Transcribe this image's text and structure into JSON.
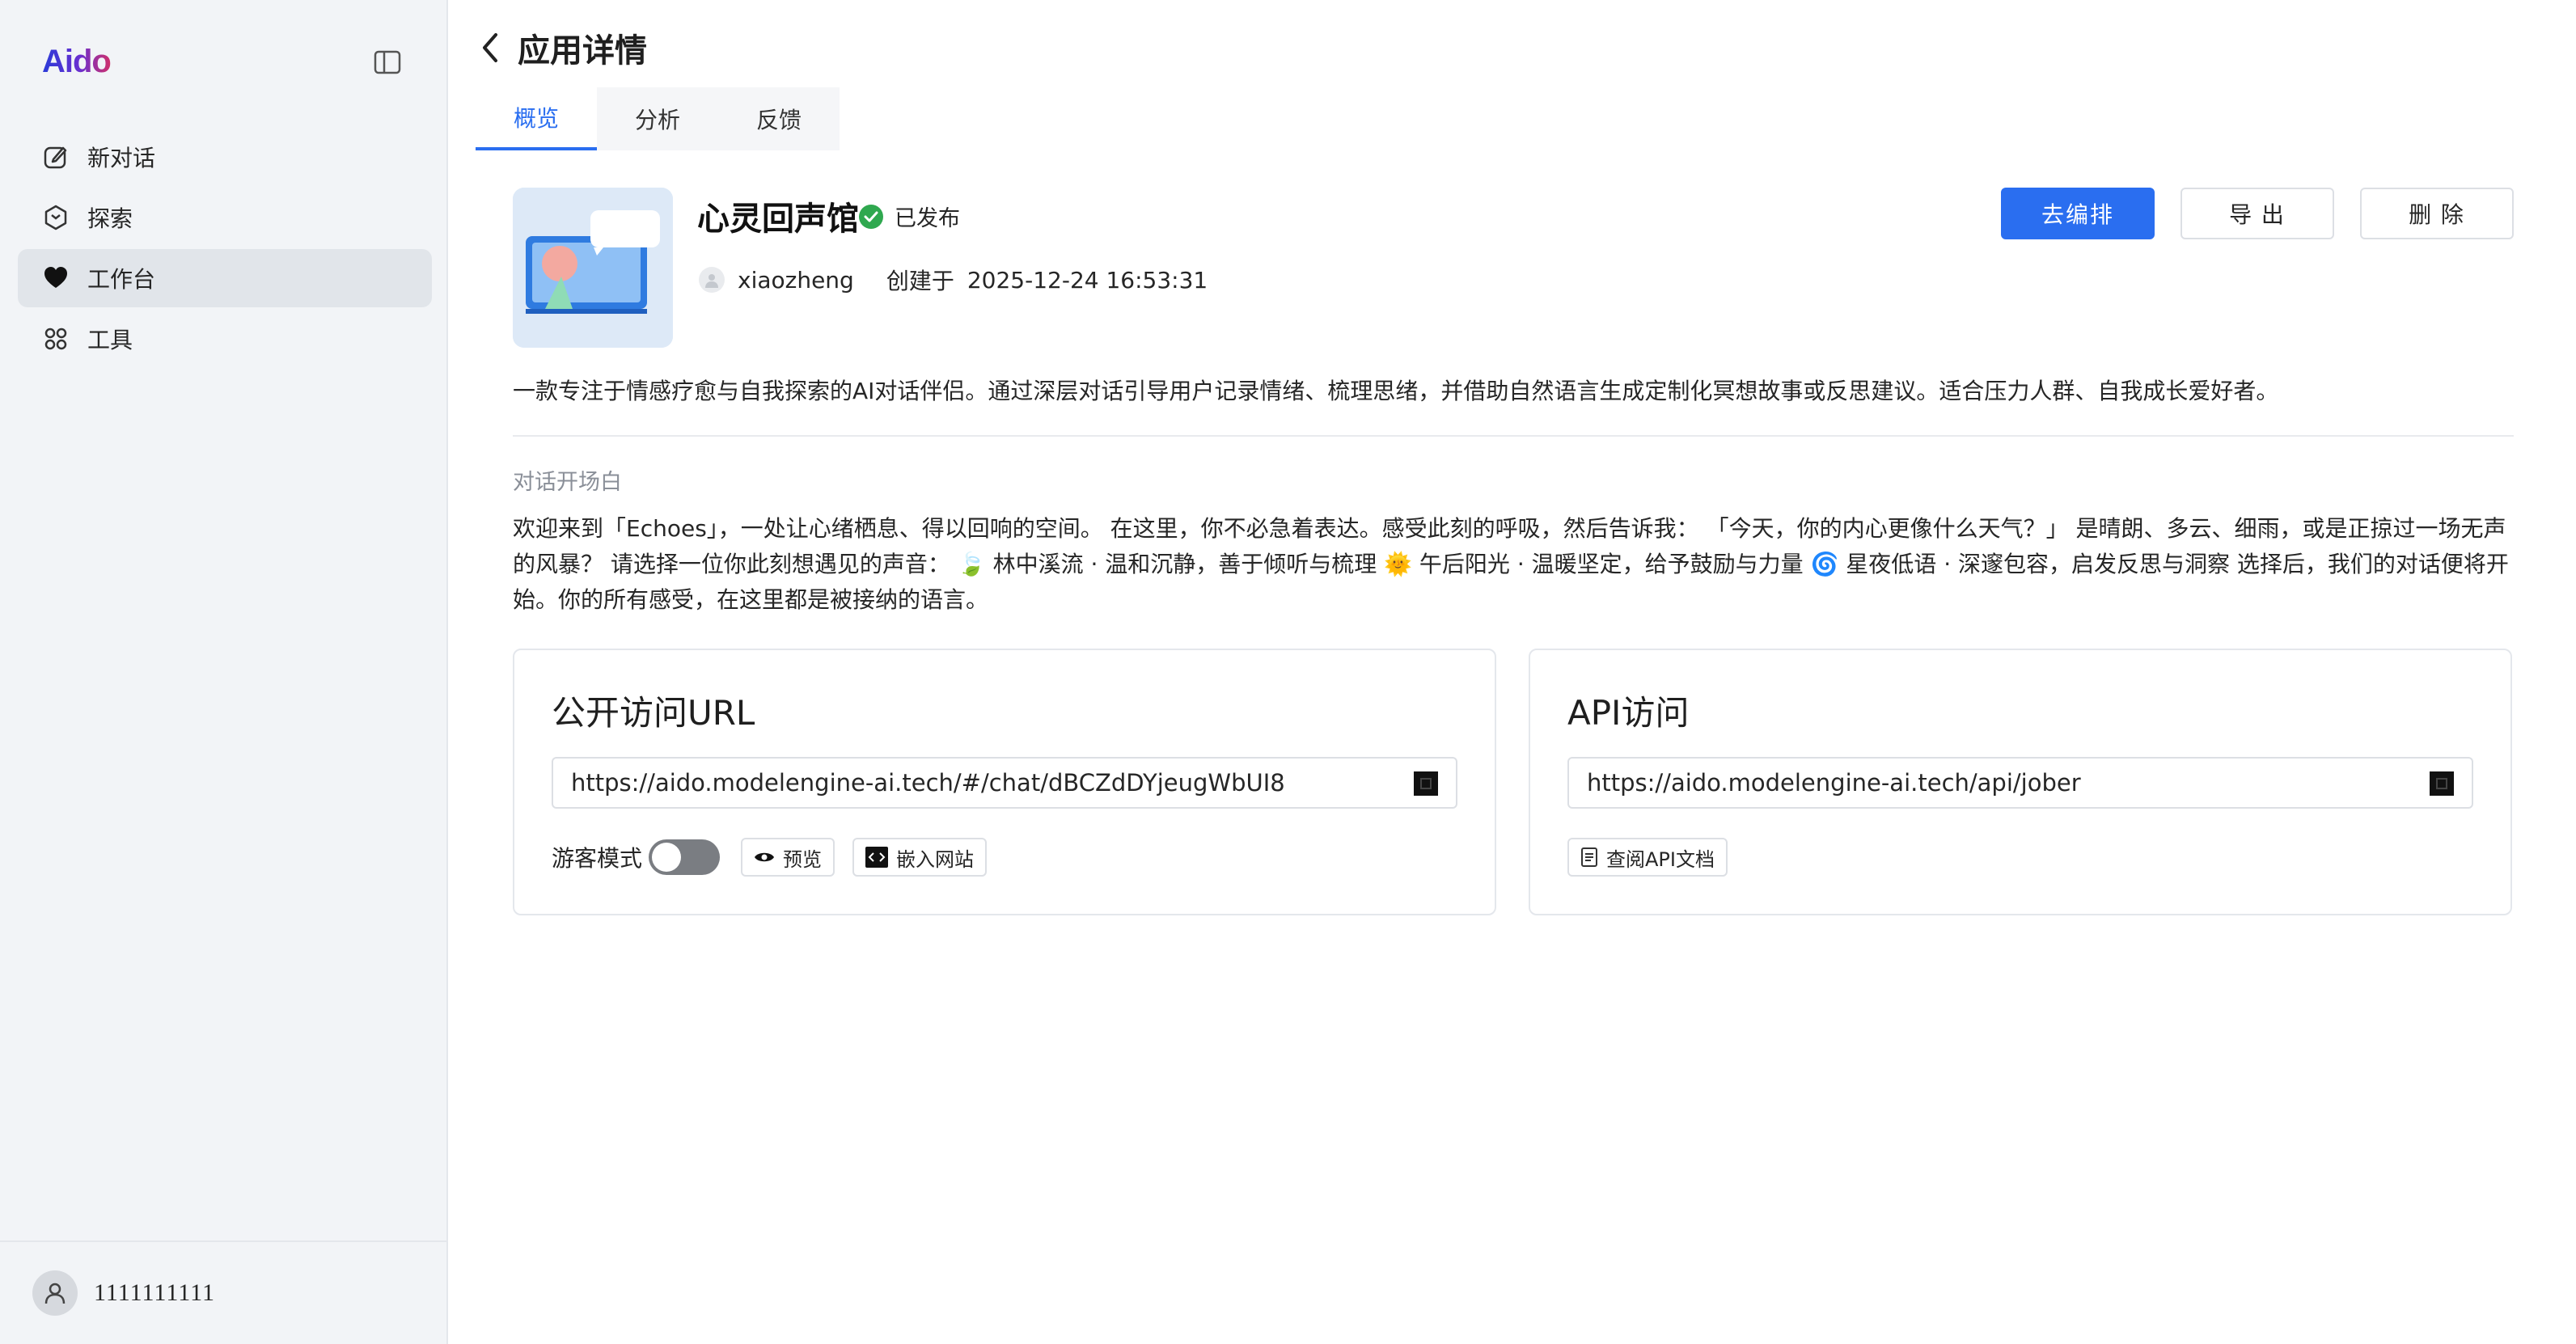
{
  "sidebar": {
    "logo": "Aido",
    "items": [
      {
        "label": "新对话",
        "icon": "edit-icon"
      },
      {
        "label": "探索",
        "icon": "explore-icon"
      },
      {
        "label": "工作台",
        "icon": "heart-icon",
        "active": true
      },
      {
        "label": "工具",
        "icon": "grid-icon"
      }
    ],
    "user": {
      "name": "1111111111"
    }
  },
  "header": {
    "title": "应用详情",
    "tabs": [
      {
        "label": "概览",
        "active": true
      },
      {
        "label": "分析"
      },
      {
        "label": "反馈"
      }
    ]
  },
  "app": {
    "name": "心灵回声馆",
    "status": "已发布",
    "author": "xiaozheng",
    "created_label": "创建于",
    "created_time": "2025-12-24 16:53:31",
    "description": "一款专注于情感疗愈与自我探索的AI对话伴侣。通过深层对话引导用户记录情绪、梳理思绪，并借助自然语言生成定制化冥想故事或反思建议。适合压力人群、自我成长爱好者。",
    "opener_label": "对话开场白",
    "opener_text": "欢迎来到「Echoes」，一处让心绪栖息、得以回响的空间。 在这里，你不必急着表达。感受此刻的呼吸，然后告诉我： 「今天，你的内心更像什么天气？」 是晴朗、多云、细雨，或是正掠过一场无声的风暴？ 请选择一位你此刻想遇见的声音： 🍃 林中溪流 · 温和沉静，善于倾听与梳理 🌞 午后阳光 · 温暖坚定，给予鼓励与力量 🌀 星夜低语 · 深邃包容，启发反思与洞察 选择后，我们的对话便将开始。你的所有感受，在这里都是被接纳的语言。"
  },
  "actions": {
    "edit": "去编排",
    "export": "导 出",
    "delete": "删 除"
  },
  "public_card": {
    "title": "公开访问URL",
    "url": "https://aido.modelengine-ai.tech/#/chat/dBCZdDYjeugWbUI8",
    "guest_label": "游客模式",
    "guest_enabled": false,
    "preview": "预览",
    "embed": "嵌入网站"
  },
  "api_card": {
    "title": "API访问",
    "url": "https://aido.modelengine-ai.tech/api/jober",
    "docs": "查阅API文档"
  },
  "colors": {
    "primary": "#2a6ef0",
    "sidebar_bg": "#f2f4f7",
    "published": "#2fa84f"
  }
}
